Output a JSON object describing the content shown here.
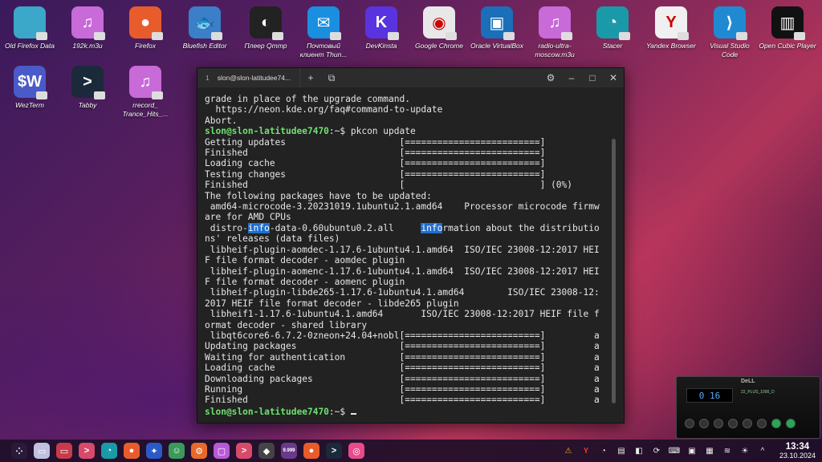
{
  "desktop": {
    "icons": [
      {
        "label": "Old Firefox Data",
        "icon": "folder-icon",
        "color": "#3ba7c9",
        "glyph": ""
      },
      {
        "label": "192k.m3u",
        "icon": "music-file-icon",
        "color": "#c86ad8",
        "glyph": "♫"
      },
      {
        "label": "Firefox",
        "icon": "firefox-icon",
        "color": "#e85c2c",
        "glyph": "●"
      },
      {
        "label": "Bluefish Editor",
        "icon": "bluefish-icon",
        "color": "#3a7fc8",
        "glyph": "🐟"
      },
      {
        "label": "Плеер Qmmp",
        "icon": "qmmp-icon",
        "color": "#222222",
        "glyph": "◐"
      },
      {
        "label": "Почтовый клиент Thun...",
        "icon": "mail-icon",
        "color": "#1a8fe0",
        "glyph": "✉"
      },
      {
        "label": "DevKinsta",
        "icon": "devkinsta-icon",
        "color": "#5a33e0",
        "glyph": "K"
      },
      {
        "label": "Google Chrome",
        "icon": "chrome-icon",
        "color": "#e8e8e8",
        "glyph": "◉"
      },
      {
        "label": "Oracle VirtualBox",
        "icon": "virtualbox-icon",
        "color": "#1a6fb8",
        "glyph": "▣"
      },
      {
        "label": "radio-ultra-moscow.m3u",
        "icon": "music-file-icon",
        "color": "#c86ad8",
        "glyph": "♫"
      },
      {
        "label": "Stacer",
        "icon": "stacer-icon",
        "color": "#1a9aa8",
        "glyph": "◔"
      },
      {
        "label": "Yandex Browser",
        "icon": "yandex-icon",
        "color": "#f0f0f0",
        "glyph": "Y"
      },
      {
        "label": "Visual Studio Code",
        "icon": "vscode-icon",
        "color": "#1f8ad2",
        "glyph": "⟩"
      },
      {
        "label": "Open Cubic Player",
        "icon": "cubic-player-icon",
        "color": "#111111",
        "glyph": "▥"
      },
      {
        "label": "WezTerm",
        "icon": "wezterm-icon",
        "color": "#4a5ac8",
        "glyph": "$W"
      },
      {
        "label": "Tabby",
        "icon": "tabby-icon",
        "color": "#1a2a3a",
        "glyph": ">"
      },
      {
        "label": "rrecord_ Trance_Hits_...",
        "icon": "music-file-icon",
        "color": "#c86ad8",
        "glyph": "♫"
      }
    ]
  },
  "terminal": {
    "tab_number": "1",
    "tab_title": "slon@slon-latitudee74...",
    "lines": [
      {
        "t": "grade in place of the upgrade command."
      },
      {
        "t": "  https://neon.kde.org/faq#command-to-update"
      },
      {
        "t": "Abort."
      },
      {
        "prompt": "slon@slon-latitudee7470",
        "t": ":~$ pkcon update"
      },
      {
        "t": "Getting updates                     [=========================]"
      },
      {
        "t": "Finished                            [=========================]"
      },
      {
        "t": "Loading cache                       [=========================]"
      },
      {
        "t": "Testing changes                     [=========================]"
      },
      {
        "t": "Finished                            [                         ] (0%)"
      },
      {
        "t": "The following packages have to be updated:"
      },
      {
        "t": " amd64-microcode-3.20231019.1ubuntu2.1.amd64    Processor microcode firmw"
      },
      {
        "t": "are for AMD CPUs"
      },
      {
        "pre": " distro-",
        "hl1": "info",
        "mid": "-data-0.60ubuntu0.2.all     ",
        "hl2": "info",
        "t": "rmation about the distributio"
      },
      {
        "t": "ns' releases (data files)"
      },
      {
        "t": " libheif-plugin-aomdec-1.17.6-1ubuntu4.1.amd64  ISO/IEC 23008-12:2017 HEI"
      },
      {
        "t": "F file format decoder - aomdec plugin"
      },
      {
        "t": " libheif-plugin-aomenc-1.17.6-1ubuntu4.1.amd64  ISO/IEC 23008-12:2017 HEI"
      },
      {
        "t": "F file format decoder - aomenc plugin"
      },
      {
        "t": " libheif-plugin-libde265-1.17.6-1ubuntu4.1.amd64        ISO/IEC 23008-12:"
      },
      {
        "t": "2017 HEIF file format decoder - libde265 plugin"
      },
      {
        "t": " libheif1-1.17.6-1ubuntu4.1.amd64       ISO/IEC 23008-12:2017 HEIF file f"
      },
      {
        "t": "ormat decoder - shared library"
      },
      {
        "t": " libqt6core6-6.7.2-0zneon+24.04+nobl[=========================]         a"
      },
      {
        "t": "Updating packages                   [=========================]         a"
      },
      {
        "t": "Waiting for authentication          [=========================]         a"
      },
      {
        "t": "Loading cache                       [=========================]         a"
      },
      {
        "t": "Downloading packages                [=========================]         a"
      },
      {
        "t": "Running                             [=========================]         a"
      },
      {
        "t": "Finished                            [=========================]         a"
      },
      {
        "prompt": "slon@slon-latitudee7470",
        "t": ":~$ ",
        "cursor": true
      }
    ]
  },
  "player": {
    "brand": "DeLL",
    "time": "0 16",
    "info": "22_PLUS_1000_D"
  },
  "taskbar": {
    "apps": [
      {
        "icon": "app-launcher-icon",
        "color": "#2a1a3a",
        "glyph": "⁘"
      },
      {
        "icon": "desktop-pager-icon",
        "color": "#c0c0e0",
        "glyph": "▭"
      },
      {
        "icon": "terminal-icon",
        "color": "#c83a4a",
        "glyph": "▭"
      },
      {
        "icon": "konsole-icon",
        "color": "#d84a6a",
        "glyph": ">"
      },
      {
        "icon": "stacer-icon",
        "color": "#1a9aa8",
        "glyph": "◔"
      },
      {
        "icon": "firefox-icon",
        "color": "#e85c2c",
        "glyph": "●"
      },
      {
        "icon": "krita-icon",
        "color": "#2a5ac8",
        "glyph": "✦"
      },
      {
        "icon": "game-icon",
        "color": "#3a9a5a",
        "glyph": "☺"
      },
      {
        "icon": "settings-icon",
        "color": "#e86a2a",
        "glyph": "⚙"
      },
      {
        "icon": "files-icon",
        "color": "#b85ad8",
        "glyph": "▢"
      },
      {
        "icon": "terminal-icon",
        "color": "#d84a6a",
        "glyph": ">"
      },
      {
        "icon": "gpu-icon",
        "color": "#444444",
        "glyph": "◆"
      },
      {
        "icon": "notification-app-icon",
        "color": "#6a3a8a",
        "glyph": "9"
      },
      {
        "icon": "firefox-icon",
        "color": "#e85c2c",
        "glyph": "●"
      },
      {
        "icon": "tabby-icon",
        "color": "#1a2a3a",
        "glyph": ">"
      },
      {
        "icon": "camera-icon",
        "color": "#e84a8a",
        "glyph": "◎"
      }
    ],
    "badge_count": "9.999",
    "tray": [
      {
        "icon": "alert-icon",
        "glyph": "⚠"
      },
      {
        "icon": "yandex-icon",
        "glyph": "Y"
      },
      {
        "icon": "browser-icon",
        "glyph": "◔"
      },
      {
        "icon": "package-icon",
        "glyph": "▤"
      },
      {
        "icon": "bag-icon",
        "glyph": "◧"
      },
      {
        "icon": "network-icon",
        "glyph": "⟳"
      },
      {
        "icon": "keyboard-icon",
        "glyph": "⌨"
      },
      {
        "icon": "storage-icon",
        "glyph": "▣"
      },
      {
        "icon": "language-flag-icon",
        "glyph": "▦"
      },
      {
        "icon": "wifi-icon",
        "glyph": "≋"
      },
      {
        "icon": "brightness-icon",
        "glyph": "☀"
      },
      {
        "icon": "tray-expand-icon",
        "glyph": "^"
      }
    ],
    "time": "13:34",
    "date": "23.10.2024"
  }
}
